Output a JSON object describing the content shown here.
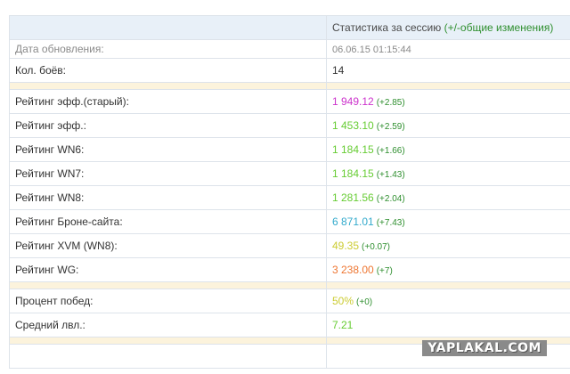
{
  "header": {
    "title": "Статистика за сессию",
    "note": "(+/-общие изменения)"
  },
  "rows": {
    "updated": {
      "label": "Дата обновления:",
      "value": "06.06.15 01:15:44"
    },
    "battles": {
      "label": "Кол. боёв:",
      "value": "14"
    },
    "eff_old": {
      "label": "Рейтинг эфф.(старый):",
      "value": "1 949.12",
      "delta": "(+2.85)",
      "color": "#cc33cc"
    },
    "eff": {
      "label": "Рейтинг эфф.:",
      "value": "1 453.10",
      "delta": "(+2.59)",
      "color": "#66cc33"
    },
    "wn6": {
      "label": "Рейтинг WN6:",
      "value": "1 184.15",
      "delta": "(+1.66)",
      "color": "#66cc33"
    },
    "wn7": {
      "label": "Рейтинг WN7:",
      "value": "1 184.15",
      "delta": "(+1.43)",
      "color": "#66cc33"
    },
    "wn8": {
      "label": "Рейтинг WN8:",
      "value": "1 281.56",
      "delta": "(+2.04)",
      "color": "#66cc33"
    },
    "armor": {
      "label": "Рейтинг Броне-сайта:",
      "value": "6 871.01",
      "delta": "(+7.43)",
      "color": "#33aacc"
    },
    "xvm": {
      "label": "Рейтинг XVM (WN8):",
      "value": "49.35",
      "delta": "(+0.07)",
      "color": "#cccc33"
    },
    "wg": {
      "label": "Рейтинг WG:",
      "value": "3 238.00",
      "delta": "(+7)",
      "color": "#ee7733"
    },
    "winrate": {
      "label": "Процент побед:",
      "value": "50%",
      "delta": "(+0)",
      "color": "#cccc33"
    },
    "avg_level": {
      "label": "Средний лвл.:",
      "value": "7.21",
      "color": "#66cc33"
    }
  },
  "watermark": "YAPLAKAL.COM"
}
